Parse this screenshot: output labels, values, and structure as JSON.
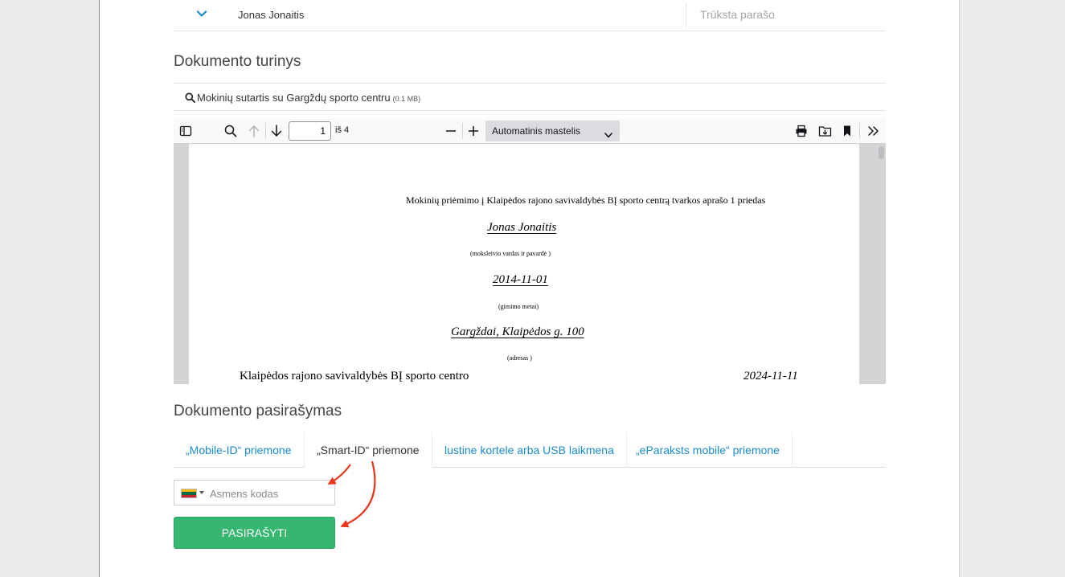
{
  "signer": {
    "name": "Jonas Jonaitis",
    "status": "Trūksta parašo"
  },
  "content_section": {
    "title": "Dokumento turinys",
    "file_name": "Mokinių sutartis su Gargždų sporto centru",
    "file_size": "(0.1 MB)"
  },
  "viewer": {
    "toolbar": {
      "current_page": "1",
      "page_total": "iš 4",
      "zoom_label": "Automatinis mastelis"
    },
    "document": {
      "heading": "Mokinių priėmimo į Klaipėdos rajono savivaldybės BĮ sporto centrą tvarkos aprašo 1 priedas",
      "student_name": "Jonas Jonaitis",
      "student_name_hint": "(moksleivio vardas ir pavardė )",
      "birth_date": "2014-11-01",
      "birth_date_hint": "(gimimo metai)",
      "address": "Gargždai, Klaipėdos g. 100",
      "address_hint": "(adresas )",
      "organization": "Klaipėdos rajono savivaldybės BĮ sporto centro",
      "document_date": "2024-11-11"
    }
  },
  "signing_section": {
    "title": "Dokumento pasirašymas",
    "tabs": [
      {
        "label": "„Mobile-ID“ priemone",
        "active": false
      },
      {
        "label": "„Smart-ID“ priemone",
        "active": true
      },
      {
        "label": "lustine kortele arba USB laikmena",
        "active": false
      },
      {
        "label": "„eParaksts mobile“ priemone",
        "active": false
      }
    ],
    "id_field": {
      "placeholder": "Asmens kodas",
      "country": "LT"
    },
    "sign_button_label": "PASIRAŠYTI"
  },
  "colors": {
    "link": "#1b8bcb",
    "primary_button": "#36b66f",
    "annotation_arrow": "#e8361c"
  },
  "icons": [
    "chevron-down-icon",
    "search-icon",
    "sidebar-toggle-icon",
    "find-icon",
    "previous-page-icon",
    "next-page-icon",
    "zoom-out-icon",
    "zoom-in-icon",
    "print-icon",
    "save-icon",
    "bookmark-icon",
    "tools-icon"
  ]
}
